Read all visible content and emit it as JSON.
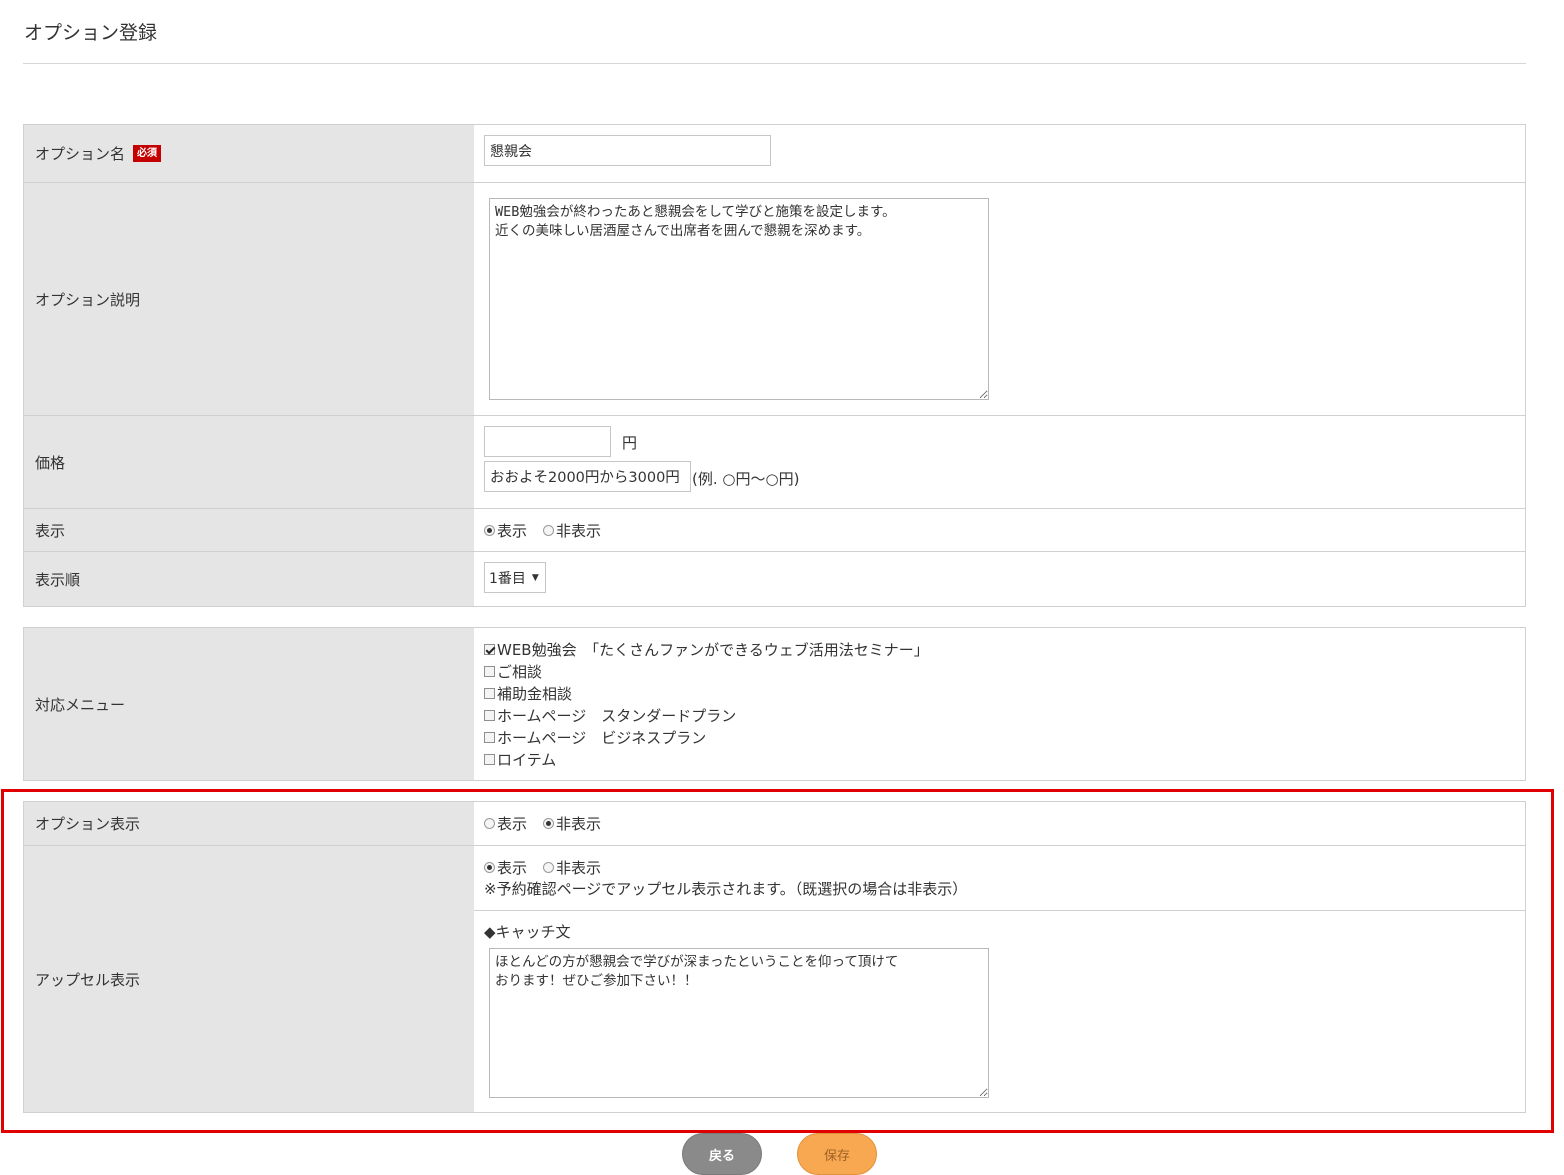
{
  "page": {
    "title": "オプション登録"
  },
  "colors": {
    "required_badge": "#c40000",
    "highlight_border": "#e00000",
    "back_button": "#8a8a8a",
    "save_button": "#f7a850"
  },
  "form1": {
    "option_name": {
      "label": "オプション名",
      "required_label": "必須",
      "value": "懇親会"
    },
    "option_description": {
      "label": "オプション説明",
      "value": "WEB勉強会が終わったあと懇親会をして学びと施策を設定します。\n近くの美味しい居酒屋さんで出席者を囲んで懇親を深めます。"
    },
    "price": {
      "label": "価格",
      "value": "",
      "unit": "円",
      "note_value": "おおよそ2000円から3000円",
      "note_example": "(例. ○円～○円)"
    },
    "display": {
      "label": "表示",
      "options": [
        "表示",
        "非表示"
      ],
      "selected": "表示"
    },
    "display_order": {
      "label": "表示順",
      "selected": "1番目"
    }
  },
  "form2": {
    "menu": {
      "label": "対応メニュー",
      "items": [
        {
          "label": "WEB勉強会　「たくさんファンができるウェブ活用法セミナー」",
          "checked": true
        },
        {
          "label": "ご相談",
          "checked": false
        },
        {
          "label": "補助金相談",
          "checked": false
        },
        {
          "label": "ホームページ　スタンダードプラン",
          "checked": false
        },
        {
          "label": "ホームページ　ビジネスプラン",
          "checked": false
        },
        {
          "label": "ロイテム",
          "checked": false
        }
      ]
    }
  },
  "form3": {
    "option_display": {
      "label": "オプション表示",
      "options": [
        "表示",
        "非表示"
      ],
      "selected": "非表示"
    },
    "upsell": {
      "label": "アップセル表示",
      "options": [
        "表示",
        "非表示"
      ],
      "selected": "表示",
      "note": "※予約確認ページでアップセル表示されます。（既選択の場合は非表示）",
      "catch_label": "◆キャッチ文",
      "catch_value": "ほとんどの方が懇親会で学びが深まったということを仰って頂けて\nおります！ぜひご参加下さい！！"
    }
  },
  "buttons": {
    "back": "戻る",
    "save": "保存"
  }
}
